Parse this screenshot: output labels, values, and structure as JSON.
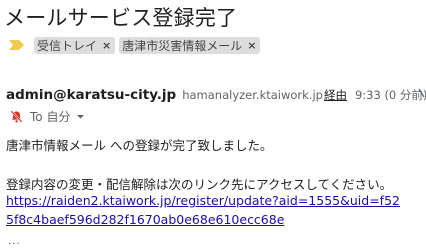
{
  "email": {
    "subject": "メールサービス登録完了",
    "labels": [
      {
        "text": "受信トレイ",
        "remove": "×"
      },
      {
        "text": "唐津市災害情報メール",
        "remove": "×"
      }
    ],
    "sender": {
      "email": "admin@karatsu-city.jp",
      "via_domain": "hamanalyzer.ktaiwork.jp",
      "via_label": "経由",
      "time": "9:33 (0 分前)"
    },
    "recipient": {
      "text": "To 自分"
    },
    "body": {
      "line1": "唐津市情報メール への登録が完了致しました。",
      "line2": "登録内容の変更・配信解除は次のリンク先にアクセスしてください。",
      "link_line1": "https://raiden2.ktaiwork.jp/register/update?aid=1555&uid=f52",
      "link_line2": "5f8c4baef596d282f1670ab0e68e610ecc68e",
      "trailing": "..."
    }
  },
  "colors": {
    "importance_marker": "#f2c94c",
    "chip_bg": "#dddddd",
    "link": "#1a0dab",
    "notice_red": "#d93025"
  }
}
